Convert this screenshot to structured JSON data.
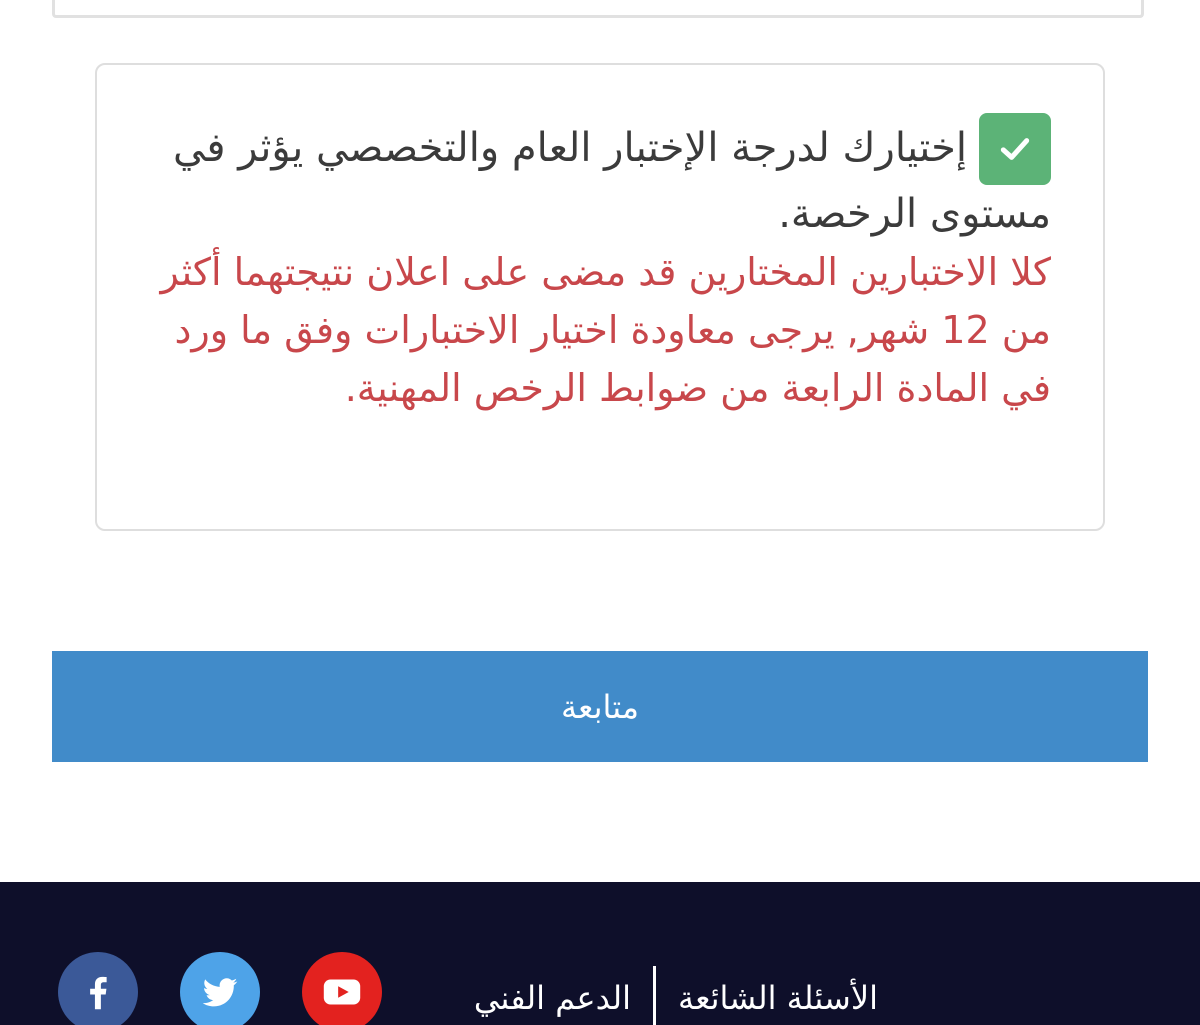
{
  "notice": {
    "agree_text": "إختيارك لدرجة الإختبار العام والتخصصي يؤثر في مستوى الرخصة.",
    "warning_text": "كلا الاختبارين المختارين قد مضى على اعلان نتيجتهما أكثر من 12 شهر, يرجى معاودة اختيار الاختبارات وفق ما ورد في المادة الرابعة من ضوابط الرخص المهنية.",
    "checkbox_checked": true,
    "checkbox_color": "#5cb377",
    "warning_color": "#c8474b"
  },
  "actions": {
    "continue_label": "متابعة",
    "continue_color": "#418bc9"
  },
  "footer": {
    "background": "#0e0f2a",
    "links": [
      {
        "label": "الأسئلة الشائعة"
      },
      {
        "label": "الدعم الفني"
      }
    ],
    "social": [
      {
        "icon": "youtube-icon",
        "color": "#e3221f"
      },
      {
        "icon": "twitter-icon",
        "color": "#4ea3e8"
      },
      {
        "icon": "facebook-icon",
        "color": "#3b5998"
      }
    ]
  }
}
